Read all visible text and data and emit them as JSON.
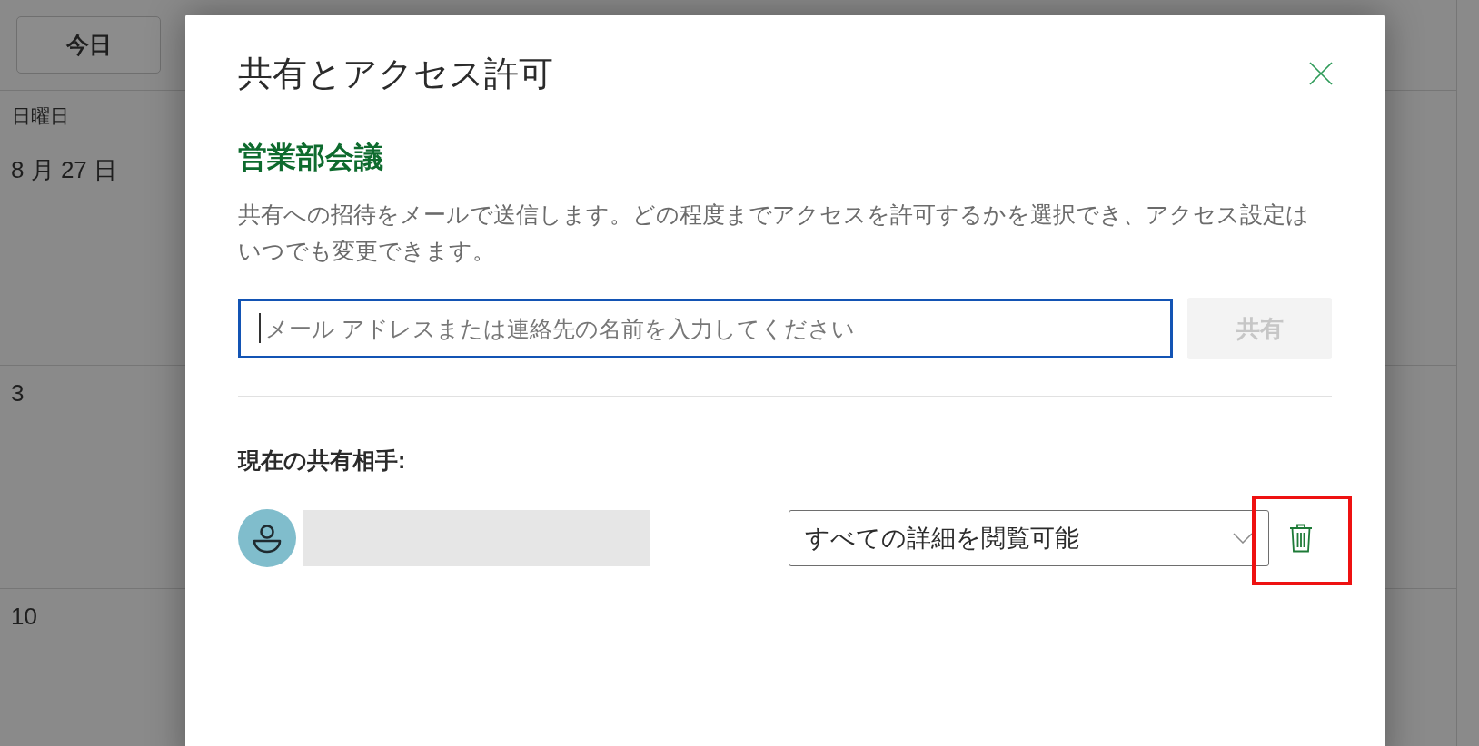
{
  "calendar": {
    "today_button": "今日",
    "day_header": "日曜日",
    "week_rows": [
      {
        "date": "8 月 27 日"
      },
      {
        "date": "3"
      },
      {
        "date": "10"
      }
    ]
  },
  "dialog": {
    "title": "共有とアクセス許可",
    "subject": "営業部会議",
    "description": "共有への招待をメールで送信します。どの程度までアクセスを許可するかを選択でき、アクセス設定はいつでも変更できます。",
    "invite_field": {
      "placeholder": "メール アドレスまたは連絡先の名前を入力してください",
      "focused": true
    },
    "share_button": {
      "label": "共有",
      "disabled": true
    },
    "shared_with_label": "現在の共有相手:",
    "shared_with": [
      {
        "access": "すべての詳細を閲覧可能",
        "remove_highlighted": true
      }
    ]
  }
}
